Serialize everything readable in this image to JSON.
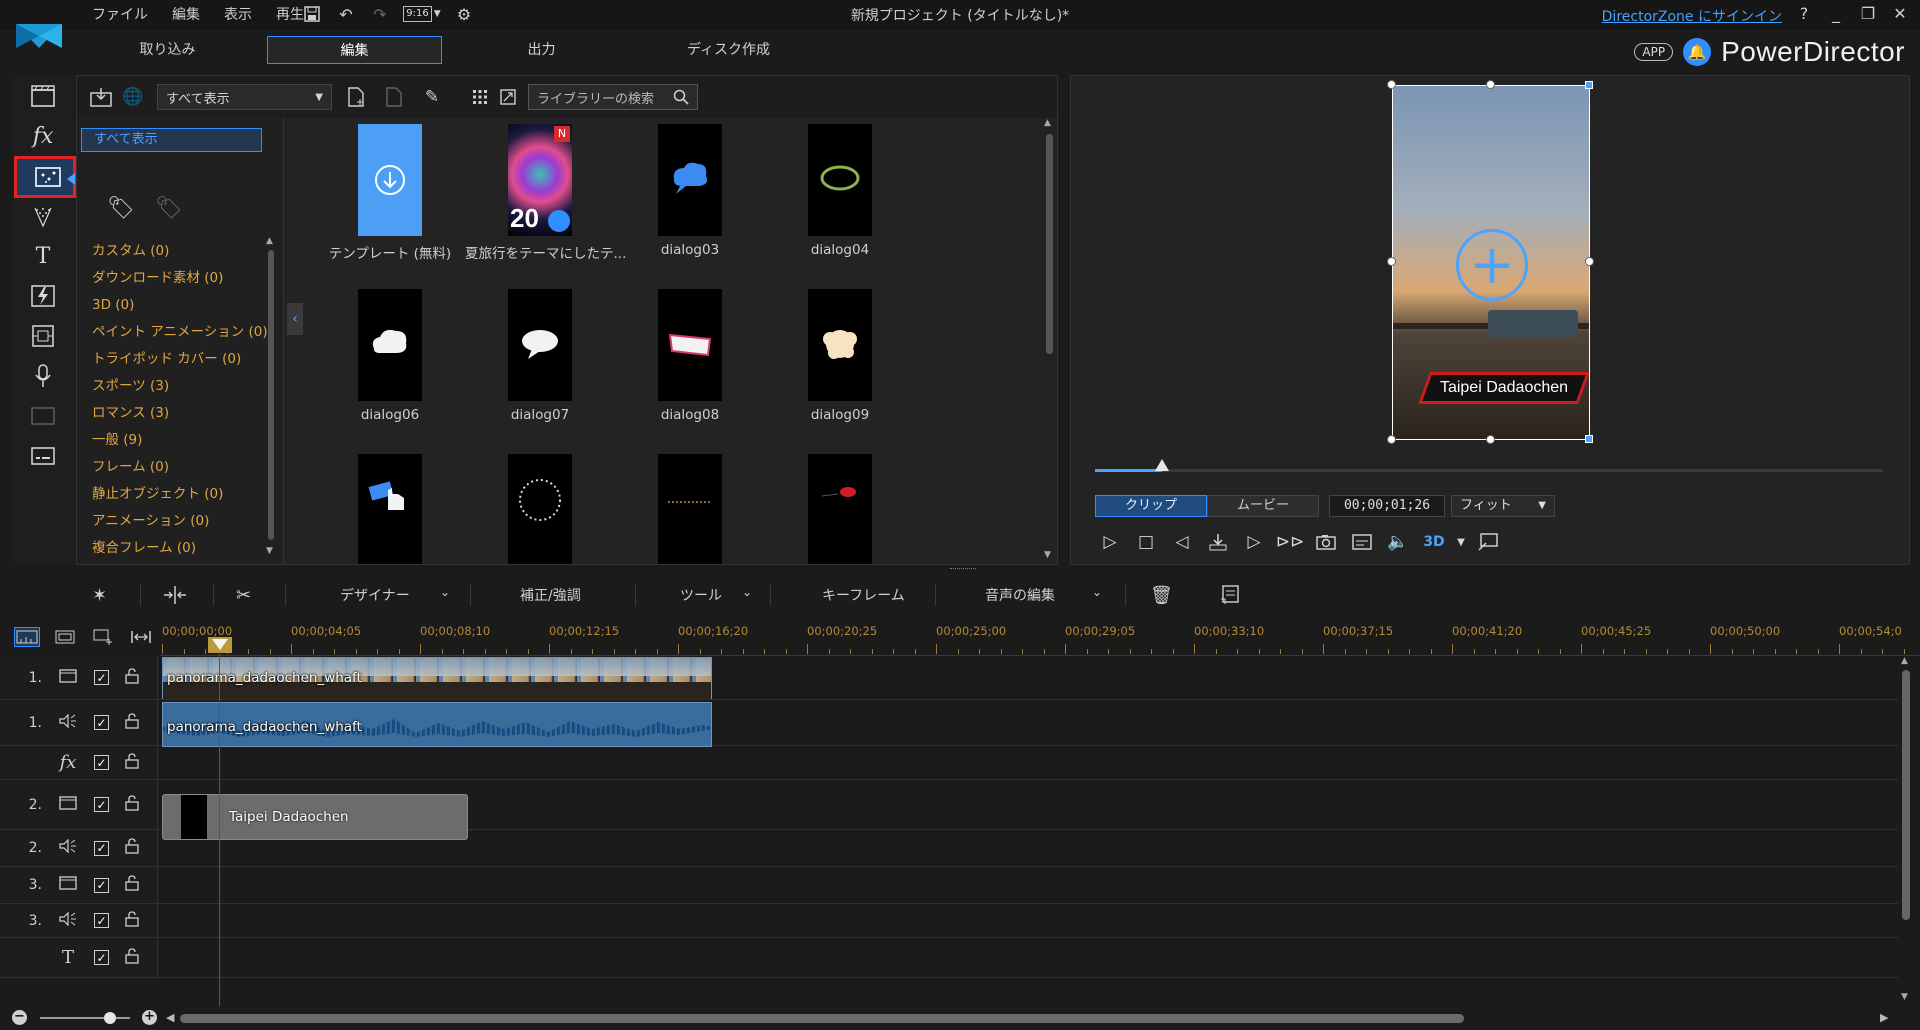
{
  "window": {
    "title": "新規プロジェクト (タイトルなし)*",
    "signin_link": "DirectorZone にサインイン",
    "help": "?",
    "minimize": "_",
    "restore": "❐",
    "close": "✕"
  },
  "menu": [
    "ファイル",
    "編集",
    "表示",
    "再生"
  ],
  "quick_access": {
    "aspect": "9:16"
  },
  "mode_tabs": [
    "取り込み",
    "編集",
    "出力",
    "ディスク作成"
  ],
  "brand": {
    "app_badge": "APP",
    "name": "PowerDirector"
  },
  "library": {
    "filter": "すべて表示",
    "search_placeholder": "ライブラリーの検索",
    "tree_selected": "すべて表示",
    "categories": [
      "カスタム (0)",
      "ダウンロード素材 (0)",
      "3D (0)",
      "ペイント アニメーション (0)",
      "トライポッド カバー (0)",
      "スポーツ (3)",
      "ロマンス (3)",
      "一般 (9)",
      "フレーム (0)",
      "静止オブジェクト (0)",
      "アニメーション (0)",
      "複合フレーム (0)"
    ],
    "items": [
      {
        "label": "テンプレート (無料)"
      },
      {
        "label": "夏旅行をテーマにしたテ...",
        "badge": "N",
        "thumb_text": "20"
      },
      {
        "label": "dialog03"
      },
      {
        "label": "dialog04"
      },
      {
        "label": "dialog06"
      },
      {
        "label": "dialog07"
      },
      {
        "label": "dialog08"
      },
      {
        "label": "dialog09"
      },
      {
        "label": ""
      },
      {
        "label": ""
      },
      {
        "label": ""
      },
      {
        "label": ""
      }
    ]
  },
  "preview": {
    "caption": "Taipei Dadaochen",
    "mode_clip": "クリップ",
    "mode_movie": "ムービー",
    "timecode": "00;00;01;26",
    "fit": "フィット",
    "progress_fraction": 0.085,
    "three_d": "3D"
  },
  "timeline_toolbar": {
    "designer": "デザイナー",
    "fix_enhance": "補正/強調",
    "tools": "ツール",
    "keyframe": "キーフレーム",
    "audio_edit": "音声の編集"
  },
  "ruler": {
    "ticks": [
      "00;00;00;00",
      "00;00;04;05",
      "00;00;08;10",
      "00;00;12;15",
      "00;00;16;20",
      "00;00;20;25",
      "00;00;25;00",
      "00;00;29;05",
      "00;00;33;10",
      "00;00;37;15",
      "00;00;41;20",
      "00;00;45;25",
      "00;00;50;00",
      "00;00;54;0"
    ]
  },
  "tracks": [
    {
      "num": "1.",
      "type": "video"
    },
    {
      "num": "1.",
      "type": "audio"
    },
    {
      "num": "",
      "type": "fx",
      "label": "fx"
    },
    {
      "num": "2.",
      "type": "video"
    },
    {
      "num": "2.",
      "type": "audio"
    },
    {
      "num": "3.",
      "type": "video"
    },
    {
      "num": "3.",
      "type": "audio"
    },
    {
      "num": "",
      "type": "title",
      "label": "T"
    }
  ],
  "clips": {
    "video": "panorama_dadaochen_whaft",
    "audio": "panorama_dadaochen_whaft",
    "title": "Taipei Dadaochen"
  },
  "colors": {
    "accent": "#2f8fff",
    "highlight": "#e32222",
    "category_text": "#e0a640",
    "ruler_text": "#b38a34",
    "playhead": "#d42222"
  }
}
